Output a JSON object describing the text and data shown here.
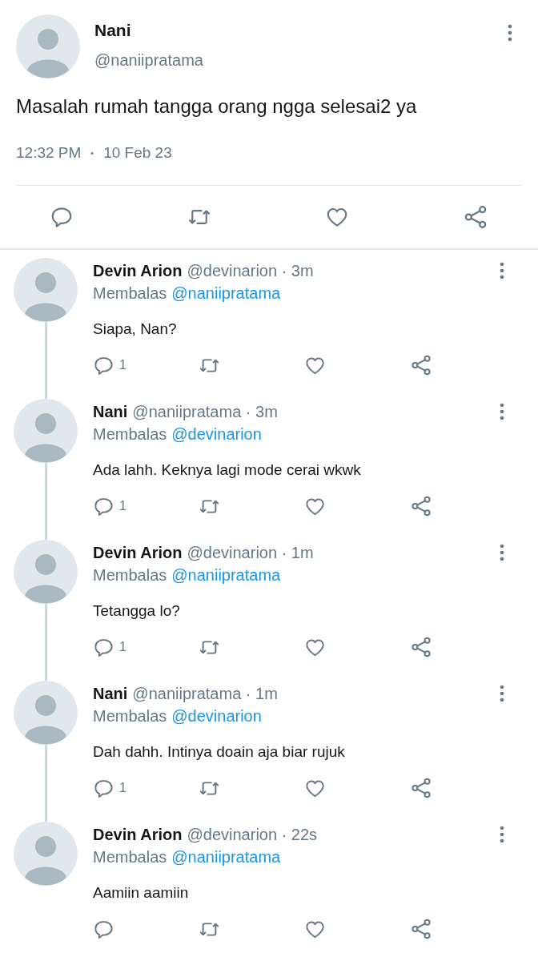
{
  "tweet": {
    "name": "Nani",
    "handle": "@naniipratama",
    "text": "Masalah rumah tangga orang ngga selesai2 ya",
    "time": "12:32 PM",
    "separator": "•",
    "date": "10 Feb 23"
  },
  "replies": [
    {
      "name": "Devin Arion",
      "meta": "@devinarion · 3m",
      "reply_prefix": "Membalas",
      "reply_to": "@naniipratama",
      "text": "Siapa, Nan?",
      "reply_count": "1"
    },
    {
      "name": "Nani",
      "meta": "@naniipratama · 3m",
      "reply_prefix": "Membalas",
      "reply_to": "@devinarion",
      "text": "Ada lahh. Keknya lagi mode cerai wkwk",
      "reply_count": "1"
    },
    {
      "name": "Devin Arion",
      "meta": "@devinarion · 1m",
      "reply_prefix": "Membalas",
      "reply_to": "@naniipratama",
      "text": "Tetangga lo?",
      "reply_count": "1"
    },
    {
      "name": "Nani",
      "meta": "@naniipratama · 1m",
      "reply_prefix": "Membalas",
      "reply_to": "@devinarion",
      "text": "Dah dahh. Intinya doain aja biar rujuk",
      "reply_count": "1"
    },
    {
      "name": "Devin Arion",
      "meta": "@devinarion · 22s",
      "reply_prefix": "Membalas",
      "reply_to": "@naniipratama",
      "text": "Aamiin aamiin"
    }
  ]
}
